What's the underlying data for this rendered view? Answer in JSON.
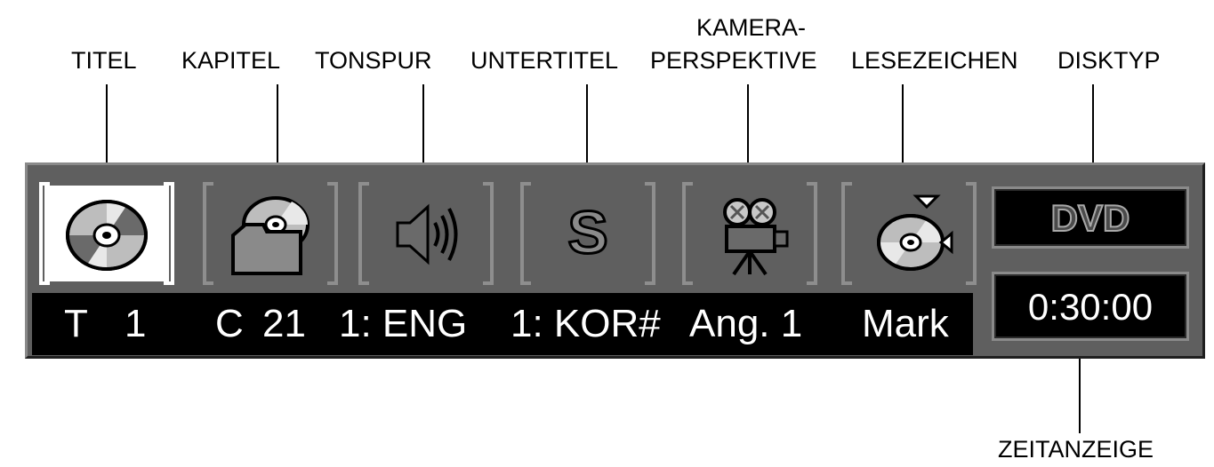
{
  "labels": {
    "titel": "TITEL",
    "kapitel": "KAPITEL",
    "tonspur": "TONSPUR",
    "untertitel": "UNTERTITEL",
    "kamera_line1": "KAMERA-",
    "kamera_line2": "PERSPEKTIVE",
    "lesezeichen": "LESEZEICHEN",
    "disktyp": "DISKTYP",
    "zeitanzeige": "ZEITANZEIGE"
  },
  "icons": [
    {
      "name": "disc-icon",
      "active": true
    },
    {
      "name": "chapter-folder-disc-icon",
      "active": false
    },
    {
      "name": "speaker-icon",
      "active": false
    },
    {
      "name": "subtitle-s-icon",
      "glyph": "S",
      "active": false
    },
    {
      "name": "film-camera-icon",
      "active": false
    },
    {
      "name": "bookmark-disc-icon",
      "active": false
    }
  ],
  "info": {
    "title_prefix": "T",
    "title_value": "1",
    "chapter_prefix": "C",
    "chapter_value": "21",
    "audio": "1: ENG",
    "subtitle": "1: KOR#",
    "angle": "Ang. 1",
    "mark": "Mark"
  },
  "disk_type": "DVD",
  "time": "0:30:00",
  "colors": {
    "panel": "#5f5f5f",
    "bracket_inactive": "#8e8e8e",
    "bracket_active": "#ffffff",
    "infobar": "#000000",
    "text": "#ffffff"
  }
}
